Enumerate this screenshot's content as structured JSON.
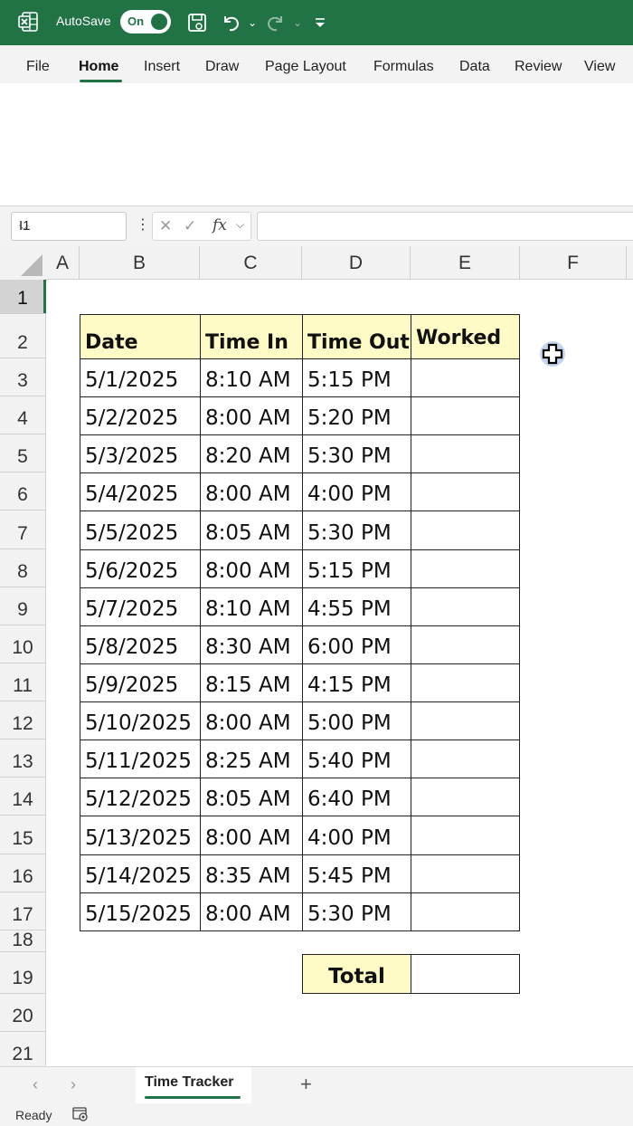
{
  "title_bar": {
    "autosave_label": "AutoSave",
    "autosave_state": "On",
    "accent_color": "#217346"
  },
  "ribbon_tabs": [
    "File",
    "Home",
    "Insert",
    "Draw",
    "Page Layout",
    "Formulas",
    "Data",
    "Review",
    "View"
  ],
  "active_tab": "Home",
  "formula_bar": {
    "name_box": "I1",
    "fx_label": "fx",
    "formula": ""
  },
  "columns": [
    "A",
    "B",
    "C",
    "D",
    "E",
    "F"
  ],
  "rows": [
    "1",
    "2",
    "3",
    "4",
    "5",
    "6",
    "7",
    "8",
    "9",
    "10",
    "11",
    "12",
    "13",
    "14",
    "15",
    "16",
    "17",
    "18",
    "19",
    "20",
    "21"
  ],
  "table": {
    "headers": [
      "Date",
      "Time In",
      "Time Out",
      "Worked"
    ],
    "header_fill": "#fefbc6",
    "rows": [
      [
        "5/1/2025",
        "8:10 AM",
        "5:15 PM",
        ""
      ],
      [
        "5/2/2025",
        "8:00 AM",
        "5:20 PM",
        ""
      ],
      [
        "5/3/2025",
        "8:20 AM",
        "5:30 PM",
        ""
      ],
      [
        "5/4/2025",
        "8:00 AM",
        "4:00 PM",
        ""
      ],
      [
        "5/5/2025",
        "8:05 AM",
        "5:30 PM",
        ""
      ],
      [
        "5/6/2025",
        "8:00 AM",
        "5:15 PM",
        ""
      ],
      [
        "5/7/2025",
        "8:10 AM",
        "4:55 PM",
        ""
      ],
      [
        "5/8/2025",
        "8:30 AM",
        "6:00 PM",
        ""
      ],
      [
        "5/9/2025",
        "8:15 AM",
        "4:15 PM",
        ""
      ],
      [
        "5/10/2025",
        "8:00 AM",
        "5:00 PM",
        ""
      ],
      [
        "5/11/2025",
        "8:25 AM",
        "5:40 PM",
        ""
      ],
      [
        "5/12/2025",
        "8:05 AM",
        "6:40 PM",
        ""
      ],
      [
        "5/13/2025",
        "8:00 AM",
        "4:00 PM",
        ""
      ],
      [
        "5/14/2025",
        "8:35 AM",
        "5:45 PM",
        ""
      ],
      [
        "5/15/2025",
        "8:00 AM",
        "5:30 PM",
        ""
      ]
    ],
    "total_label": "Total",
    "total_value": ""
  },
  "sheet_tabs": [
    "Time Tracker"
  ],
  "status": {
    "ready": "Ready"
  }
}
